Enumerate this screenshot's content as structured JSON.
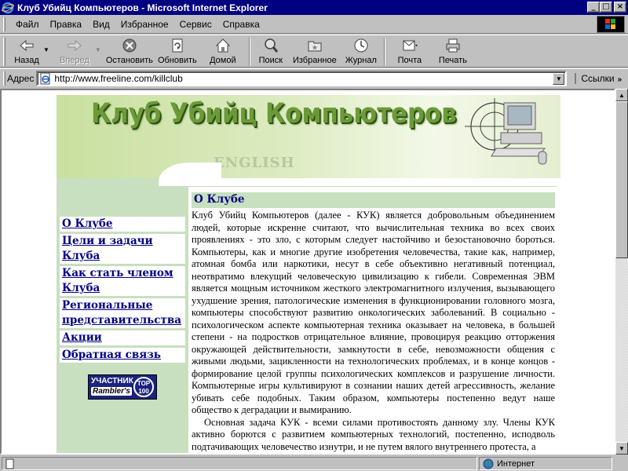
{
  "window": {
    "title": "Клуб Убийц Компьютеров - Microsoft Internet Explorer",
    "controls": {
      "minimize": "_",
      "maximize": "□",
      "close": "×"
    }
  },
  "menu": {
    "items": [
      "Файл",
      "Правка",
      "Вид",
      "Избранное",
      "Сервис",
      "Справка"
    ]
  },
  "toolbar": {
    "back": "Назад",
    "forward": "Вперед",
    "stop": "Остановить",
    "refresh": "Обновить",
    "home": "Домой",
    "search": "Поиск",
    "favorites": "Избранное",
    "history": "Журнал",
    "mail": "Почта",
    "print": "Печать"
  },
  "address": {
    "label": "Адрес",
    "url": "http://www.freeline.com/killclub",
    "links_label": "Ссылки"
  },
  "banner": {
    "title": "Клуб Убийц Компьютеров",
    "english_link": "ENGLISH"
  },
  "nav": {
    "items": [
      "О Клубе",
      "Цели и задачи Клуба",
      "Как стать членом Клуба",
      "Региональные представительства",
      "Акции",
      "Обратная связь"
    ]
  },
  "badge": {
    "line1": "УЧАСТНИК",
    "line2": "Rambler's",
    "top": "TOP 100"
  },
  "content": {
    "heading": "О Клубе",
    "paragraph1": "Клуб Убийц Компьютеров (далее - КУК) является добровольным объединением людей, которые искренне считают, что вычислительная техника во всех своих проявлениях - это зло, с которым следует настойчиво и безостановочно бороться. Компьютеры, как и многие другие изобретения человечества, такие как, например, атомная бомба или наркотики, несут в себе объективно негативный потенциал, неотвратимо влекущий человеческую цивилизацию к гибели. Современная ЭВМ является мощным источником жесткого электромагнитного излучения, вызывающего ухудшение зрения, патологические изменения в функционировании головного мозга, компьютеры способствуют развитию онкологических заболеваний. В социально - психологическом аспекте компьютерная техника оказывает на человека, в большей степени - на подростков отрицательное влияние, провоцируя реакцию отторжения окружающей действительности, замкнутости в себе, невозможности общения с живыми людьми, зацикленности на технологических проблемах, и в конце концов - формирование целой группы психологических комплексов и разрушение личности. Компьютерные игры культивируют в сознании наших детей агрессивность, желание убивать себе подобных. Таким образом, компьютеры постепенно ведут наше общество к деградации и вымиранию.",
    "paragraph2": "Основная задача КУК - всеми силами противостоять данному злу. Члены КУК активно борются с развитием компьютерных технологий, постепенно, исподволь подтачивающих человечество изнутри, и не путем вялого внутреннего протеста, а"
  },
  "status": {
    "zone": "Интернет"
  }
}
